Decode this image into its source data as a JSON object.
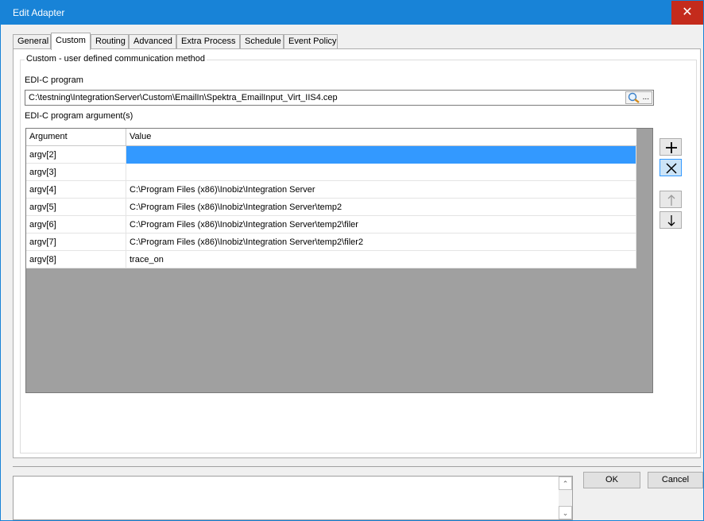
{
  "window": {
    "title": "Edit Adapter",
    "close_glyph": "✕"
  },
  "tabs": [
    {
      "label": "General"
    },
    {
      "label": "Custom",
      "active": true
    },
    {
      "label": "Routing"
    },
    {
      "label": "Advanced"
    },
    {
      "label": "Extra Process"
    },
    {
      "label": "Schedule"
    },
    {
      "label": "Event Policy"
    }
  ],
  "custom": {
    "group_label": "Custom - user defined communication method",
    "program_label": "EDI-C program",
    "program_value": "C:\\testning\\IntegrationServer\\Custom\\EmailIn\\Spektra_EmailInput_Virt_IIS4.cep",
    "browse_label": "...",
    "args_label": "EDI-C program argument(s)"
  },
  "grid": {
    "columns": [
      "Argument",
      "Value"
    ],
    "rows": [
      {
        "argument": "argv[2]",
        "value": ""
      },
      {
        "argument": "argv[3]",
        "value": ""
      },
      {
        "argument": "argv[4]",
        "value": "C:\\Program Files (x86)\\Inobiz\\Integration Server"
      },
      {
        "argument": "argv[5]",
        "value": "C:\\Program Files (x86)\\Inobiz\\Integration Server\\temp2"
      },
      {
        "argument": "argv[6]",
        "value": "C:\\Program Files (x86)\\Inobiz\\Integration Server\\temp2\\filer"
      },
      {
        "argument": "argv[7]",
        "value": "C:\\Program Files (x86)\\Inobiz\\Integration Server\\temp2\\filer2"
      },
      {
        "argument": "argv[8]",
        "value": "trace_on"
      }
    ]
  },
  "side_buttons": [
    {
      "name": "add-argument-button",
      "icon": "plus-icon"
    },
    {
      "name": "delete-argument-button",
      "icon": "close-icon"
    },
    {
      "name": "move-up-button",
      "icon": "arrow-up-icon"
    },
    {
      "name": "move-down-button",
      "icon": "arrow-down-icon"
    }
  ],
  "footer": {
    "ok_label": "OK",
    "cancel_label": "Cancel",
    "scroll_up": "⌃",
    "scroll_down": "⌄"
  },
  "colors": {
    "title_bar": "#1883d7",
    "close_button": "#c42b1c",
    "selection": "#3399ff",
    "grid_background": "#a0a0a0"
  }
}
